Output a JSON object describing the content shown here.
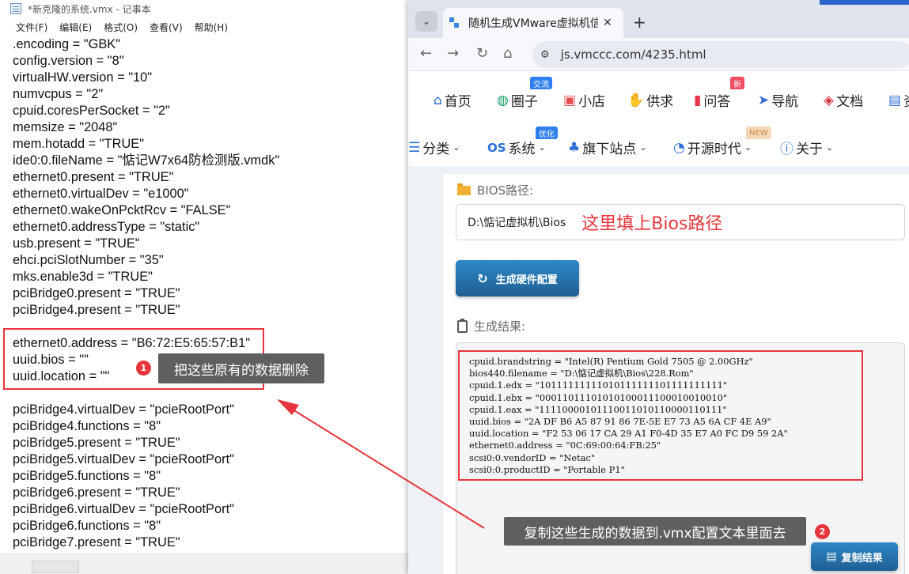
{
  "notepad": {
    "title": "*新克隆的系统.vmx - 记事本",
    "menu": [
      "文件(F)",
      "编辑(E)",
      "格式(O)",
      "查看(V)",
      "帮助(H)"
    ],
    "lines": [
      ".encoding = \"GBK\"",
      "config.version = \"8\"",
      "virtualHW.version = \"10\"",
      "numvcpus = \"2\"",
      "cpuid.coresPerSocket = \"2\"",
      "memsize = \"2048\"",
      "mem.hotadd = \"TRUE\"",
      "ide0:0.fileName = \"惦记W7x64防检测版.vmdk\"",
      "ethernet0.present = \"TRUE\"",
      "ethernet0.virtualDev = \"e1000\"",
      "ethernet0.wakeOnPcktRcv = \"FALSE\"",
      "ethernet0.addressType = \"static\"",
      "usb.present = \"TRUE\"",
      "ehci.pciSlotNumber = \"35\"",
      "mks.enable3d = \"TRUE\"",
      "pciBridge0.present = \"TRUE\"",
      "pciBridge4.present = \"TRUE\"",
      "",
      "ethernet0.address = \"B6:72:E5:65:57:B1\"",
      "uuid.bios = \"\"",
      "uuid.location = \"\"",
      "",
      "pciBridge4.virtualDev = \"pcieRootPort\"",
      "pciBridge4.functions = \"8\"",
      "pciBridge5.present = \"TRUE\"",
      "pciBridge5.virtualDev = \"pcieRootPort\"",
      "pciBridge5.functions = \"8\"",
      "pciBridge6.present = \"TRUE\"",
      "pciBridge6.virtualDev = \"pcieRootPort\"",
      "pciBridge6.functions = \"8\"",
      "pciBridge7.present = \"TRUE\""
    ],
    "annotation": {
      "badge": "1",
      "text": "把这些原有的数据删除"
    }
  },
  "browser": {
    "tab_title": "随机生成VMware虚拟机信息 –",
    "tab_close": "✕",
    "new_tab": "+",
    "url": "js.vmccc.com/4235.html",
    "nav_primary": [
      {
        "icon": "⌂",
        "label": "首页",
        "color": "#2b6fd6"
      },
      {
        "icon": "◍",
        "label": "圈子",
        "color": "#1a9e6a",
        "badge": "交流",
        "badge_color": "#2f7ff0"
      },
      {
        "icon": "▣",
        "label": "小店",
        "color": "#e24d4d"
      },
      {
        "icon": "✋",
        "label": "供求",
        "color": "#e0703a"
      },
      {
        "icon": "▮",
        "label": "问答",
        "color": "#e8354a",
        "badge": "新",
        "badge_color": "#ef4c62"
      },
      {
        "icon": "➤",
        "label": "导航",
        "color": "#3a6fd8"
      },
      {
        "icon": "◈",
        "label": "文档",
        "color": "#d8354a"
      },
      {
        "icon": "▤",
        "label": "资",
        "color": "#2b6fd6"
      }
    ],
    "nav_secondary": [
      {
        "icon": "☰",
        "label": "分类",
        "color": "#2b6fd6"
      },
      {
        "icon": "OS",
        "label": "系统",
        "color": "#2b6fd6",
        "badge": "优化",
        "badge_color": "#2f7ff0"
      },
      {
        "icon": "♣",
        "label": "旗下站点",
        "color": "#2b6fd6"
      },
      {
        "icon": "◔",
        "label": "开源时代",
        "color": "#2b6fd6",
        "badge": "NEW",
        "badge_color": "#f5d9b8"
      },
      {
        "icon": "ⓘ",
        "label": "关于",
        "color": "#2b6fd6"
      }
    ],
    "bios_label": "BIOS路径:",
    "bios_value": "D:\\惦记虚拟机\\Bios",
    "bios_hint": "这里填上Bios路径",
    "generate_button": "生成硬件配置",
    "result_label": "生成结果:",
    "result_lines": [
      "cpuid.brandstring = \"Intel(R) Pentium Gold 7505 @ 2.00GHz\"",
      "bios440.filename = \"D:\\惦记虚拟机\\Bios\\228.Rom\"",
      "cpuid.1.edx = \"10111111111010111111101111111111\"",
      "cpuid.1.ebx = \"00011011101010100011100010010010\"",
      "cpuid.1.eax = \"11110000101110011010110000110111\"",
      "uuid.bios = \"2A DF B6 A5 87 91 86 7E-5E E7 73 A5 6A CF 4E A9\"",
      "uuid.location = \"F2 53 06 17 CA 29 A1 F0-4D 35 E7 A0 FC D9 59 2A\"",
      "ethernet0.address = \"0C:69:00:64:FB:25\"",
      "scsi0:0.vendorID = \"Netac\"",
      "scsi0:0.productID = \"Portable P1\""
    ],
    "annotation": {
      "badge": "2",
      "text": "复制这些生成的数据到.vmx配置文本里面去"
    },
    "copy_button": "复制结果"
  },
  "colors": {
    "annotation_red": "#e8353d",
    "button_blue": "#2f88c9",
    "tooltip_gray": "#5f5f5f"
  }
}
